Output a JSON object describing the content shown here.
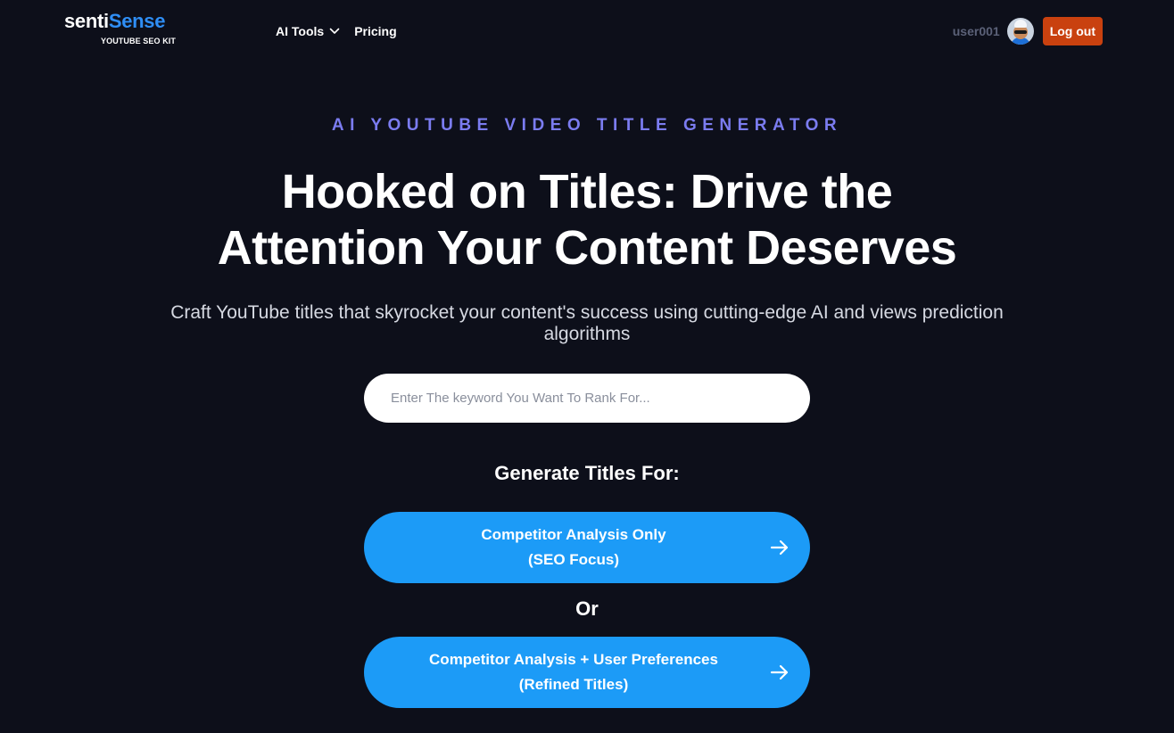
{
  "header": {
    "logo": {
      "part1": "senti",
      "part2": "Sense",
      "tagline": "YOUTUBE SEO KIT"
    },
    "nav": [
      {
        "label": "AI Tools",
        "has_dropdown": true
      },
      {
        "label": "Pricing",
        "has_dropdown": false
      }
    ],
    "user": {
      "username": "user001",
      "logout_label": "Log out"
    }
  },
  "hero": {
    "eyebrow": "AI YOUTUBE VIDEO TITLE GENERATOR",
    "headline_line1": "Hooked on Titles: Drive the",
    "headline_line2": "Attention Your Content Deserves",
    "subtitle": "Craft YouTube titles that skyrocket your content's success using cutting-edge AI and views prediction algorithms",
    "search_placeholder": "Enter The keyword You Want To Rank For...",
    "generate_label": "Generate Titles For:",
    "option1": {
      "line1": "Competitor Analysis Only",
      "line2": "(SEO Focus)"
    },
    "or_label": "Or",
    "option2": {
      "line1": "Competitor Analysis + User Preferences",
      "line2": "(Refined Titles)"
    }
  },
  "colors": {
    "background": "#0d0f1a",
    "brand_accent": "#2f8ef5",
    "eyebrow": "#7b7cf0",
    "primary_button": "#1c9bf7",
    "logout_button": "#c9410f"
  },
  "icons": [
    "chevron-down-icon",
    "avatar",
    "arrow-right-icon"
  ]
}
